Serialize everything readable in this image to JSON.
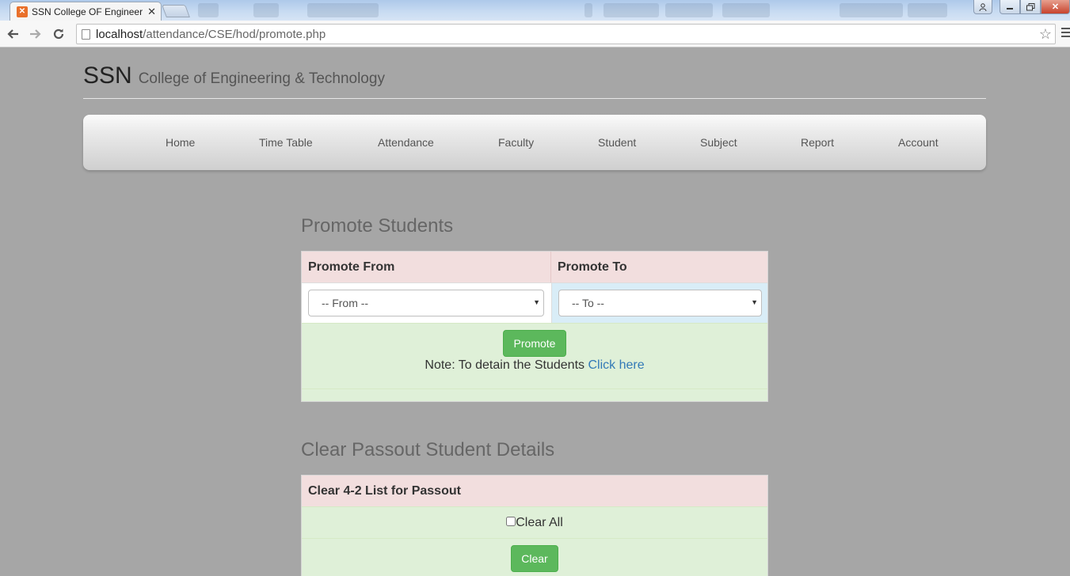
{
  "browser": {
    "tab_title": "SSN College OF Engineering",
    "url_host": "localhost",
    "url_path": "/attendance/CSE/hod/promote.php"
  },
  "header": {
    "brand": "SSN",
    "subtitle": "College of Engineering & Technology"
  },
  "nav": {
    "items": [
      "Home",
      "Time Table",
      "Attendance",
      "Faculty",
      "Student",
      "Subject",
      "Report",
      "Account"
    ]
  },
  "promote": {
    "title": "Promote Students",
    "from_header": "Promote From",
    "to_header": "Promote To",
    "from_selected": "-- From --",
    "to_selected": "-- To --",
    "button_label": "Promote",
    "note_text": "Note: To detain the Students ",
    "note_link": "Click here"
  },
  "clear": {
    "title": "Clear Passout Student Details",
    "header": "Clear 4-2 List for Passout",
    "checkbox_label": "Clear All",
    "checkbox_checked": false,
    "button_label": "Clear"
  },
  "colors": {
    "page_bg": "#a6a6a6",
    "header_row": "#f2dede",
    "success_row": "#dff0d8",
    "info_row": "#d9edf7",
    "button_green": "#5cb85c",
    "link": "#337ab7"
  }
}
